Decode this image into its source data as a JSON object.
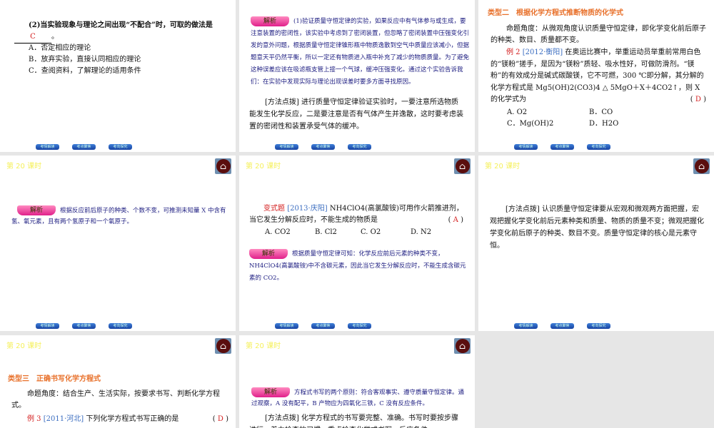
{
  "nav": [
    "考情解读",
    "考点聚焦",
    "考向探究"
  ],
  "header": "第 20 课时",
  "home_icon": "home-icon",
  "badge": "解析",
  "s1": {
    "q": "(2)当实验现象与理论之间出现“不配合”时，可取的做法是",
    "answer": "C",
    "end": "。",
    "options": [
      "A．否定相应的理论",
      "B．放弃实验，直接认同相应的理论",
      "C．查阅资料，了解理论的适用条件"
    ]
  },
  "s2": {
    "analysis": "(1)验证质量守恒定律的实验，如果反应中有气体参与或生成，要注意装置的密闭性，该实验中考虑到了密闭装置，但忽略了密闭装置中压强变化引发的意外问题，根据质量守恒定律锥形瓶中物质逸散到空气中质量应该减小，但据题意天平仍然平衡，所以一定还有物质进入瓶中补充了减少的物质质量。为了避免这种误差应该在吸滤瓶支管上接一个气球，缓冲压强变化。通过这个实验告诉我们：在实验中发现实际与理论出现误差时要多方面寻找原因。",
    "method_label": "[方法点拨]",
    "method": "进行质量守恒定律验证实验时，一要注意所选物质能发生化学反应，二是要注意是否有气体产生并逸散，这时要考虑装置的密闭性和装置承受气体的缓冲。"
  },
  "s3": {
    "title": "类型二　根据化学方程式推断物质的化学式",
    "angle": "命题角度：从微观角度认识质量守恒定律，即化学变化前后原子的种类、数目、质量都不变。",
    "ex_label": "例 2",
    "ex_src": "[2012·衡阳]",
    "ex_text": "在奥运比赛中，举重运动员举重前常用白色的“镁粉”搓手，是因为“镁粉”质轻、吸水性好，可做防滑剂。“镁粉”的有效成分是碱式碳酸镁，它不可燃，300 ℃即分解，其分解的化学方程式是 Mg5(OH)2(CO3)4 △ 5MgO＋X＋4CO2↑，则 X 的化学式为",
    "answer": "D",
    "options": [
      "A. O2",
      "B．CO",
      "C．Mg(OH)2",
      "D．H2O"
    ]
  },
  "s4": {
    "analysis": "根据反应前后原子的种类、个数不变，可推测未知量 X 中含有氢、氧元素，且有两个氢原子和一个氧原子。"
  },
  "s5": {
    "label": "变式题",
    "src": "[2013·庆阳]",
    "q": "NH4ClO4(高氯酸铵)可用作火箭推进剂，当它发生分解反应时，不能生成的物质是",
    "answer": "A",
    "options": [
      "A. CO2",
      "B. Cl2",
      "C. O2",
      "D. N2"
    ],
    "analysis": "根据质量守恒定律可知：化学反应前后元素的种类不变，NH4ClO4(高氯酸铵)中不含碳元素，因此当它发生分解反应时，不能生成含碳元素的 CO2。"
  },
  "s6": {
    "method_label": "[方法点拨]",
    "method": "认识质量守恒定律要从宏观和微观两方面把握，宏观把握化学变化前后元素种类和质量、物质的质量不变；微观把握化学变化前后原子的种类、数目不变。质量守恒定律的核心是元素守恒。"
  },
  "s7": {
    "title": "类型三　正确书写化学方程式",
    "angle": "命题角度：结合生产、生活实际，按要求书写、判断化学方程式。",
    "ex_label": "例 3",
    "ex_src": "[2011·河北]",
    "ex_text": "下列化学方程式书写正确的是",
    "answer": "D"
  },
  "s8": {
    "analysis": "方程式书写的两个原则：符合客观事实、遵守质量守恒定律。通过观察，A 没有配平，B 产物应为四氧化三铁，C 没有反应条件。",
    "method_label": "[方法点拨]",
    "method": "化学方程式的书写要完整、准确。书写时要按步骤进行，着力检查的习惯，重点检查化学式书写、反应条件"
  }
}
